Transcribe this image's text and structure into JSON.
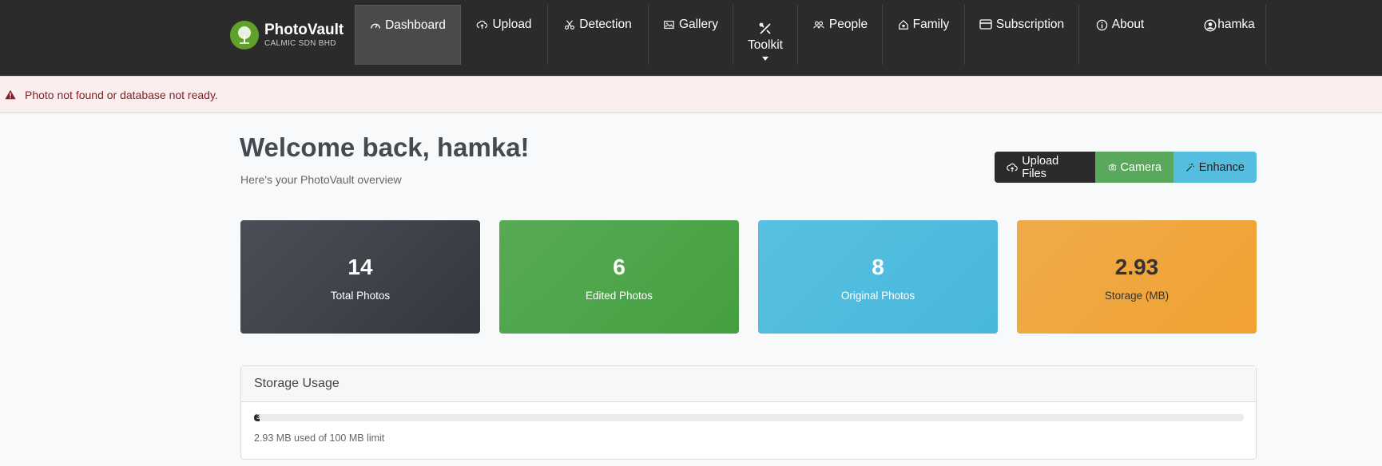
{
  "brand": {
    "name": "PhotoVault",
    "company": "CALMIC SDN BHD"
  },
  "nav": {
    "dashboard": "Dashboard",
    "upload": "Upload",
    "detection": "Detection",
    "gallery": "Gallery",
    "toolkit": "Toolkit",
    "people": "People",
    "family": "Family",
    "subscription": "Subscription",
    "about": "About",
    "user": "hamka"
  },
  "alert": {
    "message": "Photo not found or database not ready."
  },
  "header": {
    "welcome": "Welcome back, hamka!",
    "subtitle": "Here's your PhotoVault overview"
  },
  "actions": {
    "upload": "Upload Files",
    "camera": "Camera",
    "enhance": "Enhance"
  },
  "stats": [
    {
      "value": "14",
      "label": "Total Photos"
    },
    {
      "value": "6",
      "label": "Edited Photos"
    },
    {
      "value": "8",
      "label": "Original Photos"
    },
    {
      "value": "2.93",
      "label": "Storage (MB)"
    }
  ],
  "storage": {
    "title": "Storage Usage",
    "percent": 3,
    "percent_label": "3",
    "usage_text": "2.93 MB used of 100 MB limit"
  },
  "colors": {
    "navbar": "#2b2b2b",
    "dark_card": "#3f434a",
    "green_card": "#4fa44b",
    "blue_card": "#4fbbdf",
    "orange_card": "#f0a63e",
    "alert_text": "#842029"
  }
}
